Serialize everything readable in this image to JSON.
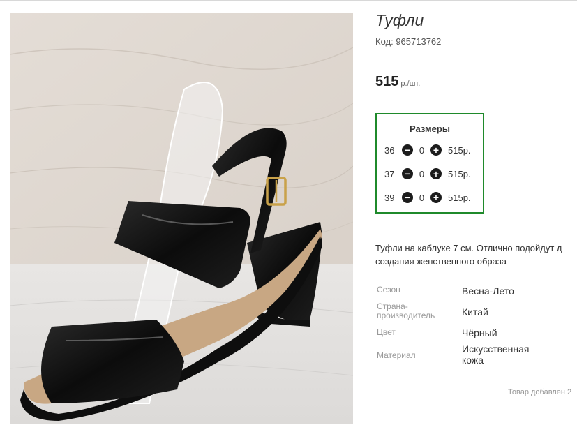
{
  "product": {
    "title": "Туфли",
    "code": "Код: 965713762",
    "price": "515",
    "price_unit": "р./шт."
  },
  "sizes": {
    "title": "Размеры",
    "rows": [
      {
        "size": "36",
        "qty": "0",
        "price": "515р."
      },
      {
        "size": "37",
        "qty": "0",
        "price": "515р."
      },
      {
        "size": "39",
        "qty": "0",
        "price": "515р."
      }
    ]
  },
  "description": {
    "line1": "Туфли на каблуке 7 см. Отлично подойдут д",
    "line2": "создания женственного образа"
  },
  "properties": [
    {
      "label": "Сезон",
      "value": "Весна-Лето"
    },
    {
      "label": "Страна-производитель",
      "value": "Китай"
    },
    {
      "label": "Цвет",
      "value": "Чёрный"
    },
    {
      "label": "Материал",
      "value": "Искусственная кожа"
    }
  ],
  "added_text": "Товар добавлен 2",
  "icons": {
    "minus": "minus-circle-icon",
    "plus": "plus-circle-icon"
  },
  "colors": {
    "sizes_border": "#1f8a2b",
    "button": "#1c1c1c",
    "label_gray": "#999999"
  }
}
